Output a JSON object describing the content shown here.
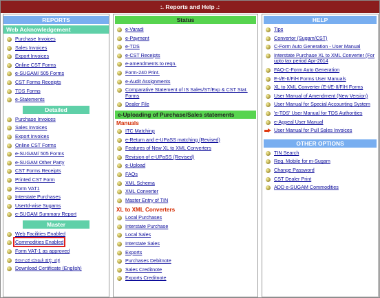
{
  "title": ":. Reports and Help .:",
  "col1": {
    "reports_header": "REPORTS",
    "web_ack": {
      "title": "Web Acknowledgement",
      "items": [
        "Purchase Invoices",
        "Sales Invoices",
        "Export Invoices",
        "Online CST Forms",
        "e-SUGAM/ 505 Forms",
        "CST Forms Receipts",
        "TDS Forms",
        "e-Statements"
      ]
    },
    "detailed": {
      "title": "Detailed",
      "items": [
        "Purchase Invoices",
        "Sales Invoices",
        "Export Invoices",
        "Online CST Forms",
        "e-SUGAM/ 505 Forms",
        "e-SUGAM Other Party",
        "CST Forms Receipts",
        "Printed CST Form",
        "Form VAT1",
        "Interstate Purchases",
        "UserId-wise Sugams",
        "e-SUGAM Summary Report"
      ]
    },
    "master": {
      "title": "Master",
      "items": [
        "Web Facilities Enabled",
        "Commodities Enabled",
        "Form VAT-1 as approved",
        "ಕರ್ನಾಟಕ ಮಾಹಿತಿ ಹಕ್ಕು ಪತ್ರ",
        "Download Certificate (English)"
      ]
    }
  },
  "col2": {
    "status": {
      "title": "Status",
      "items": [
        "e-Varadi",
        "e-Payment",
        "e-TDS",
        "e-CST Receipts",
        "e-amendments to reqn.",
        "Form-240 Print.",
        "e-Audit Assignments",
        "Comparative Statement of IS Sales/ST/Exp & CST Stat. Forms",
        "Dealer File"
      ]
    },
    "uploading_title": "e-Uploading of Purchase/Sales statements",
    "manuals": {
      "title": "Manuals",
      "items": [
        "ITC Matching",
        "e-Return and e-UPaSS matching (Revised)",
        "Features of New XL to XML Converters",
        "Revision of e-UPaSS (Revised)",
        "e-Upload",
        "FAQs",
        "XML Schema",
        "XML Converter",
        "Master Entry of TIN"
      ]
    },
    "converters": {
      "title": "XL to XML Converters",
      "items": [
        "Local Purchases",
        "Interstate Purchase",
        "Local Sales",
        "Interstate Sales",
        "Exports",
        "Purchases Debitnote",
        "Sales Creditnote",
        "Exports Creditnote"
      ]
    }
  },
  "col3": {
    "help": {
      "title": "HELP",
      "items": [
        "Tips",
        "Convertor (Sugam/CST)",
        "C-Form Auto Generation - User Manual",
        "Interstate Purchase XL to XML Converter (For upto tax period Apr-2014",
        "FAQ-C-Form Auto Generation",
        "E-I/E-II/F/H Forms User Manuals",
        "XL to XML Converter (E-I/E-II/F/H Forms",
        "User Manual of Amendment (New Version)",
        "User Manual for Special Accounting System",
        "'e-TDS' User Manual for TDS Authorities",
        "e-Appeal User Manual",
        "User Manual for Pull Sales Invoices"
      ]
    },
    "other": {
      "title": "OTHER OPTIONS",
      "items": [
        "TIN Search",
        "Reg. Mobile for m-Sugam",
        "Change Password",
        "CST Dealer Print",
        "ADD e-SUGAM Commodities"
      ]
    }
  }
}
